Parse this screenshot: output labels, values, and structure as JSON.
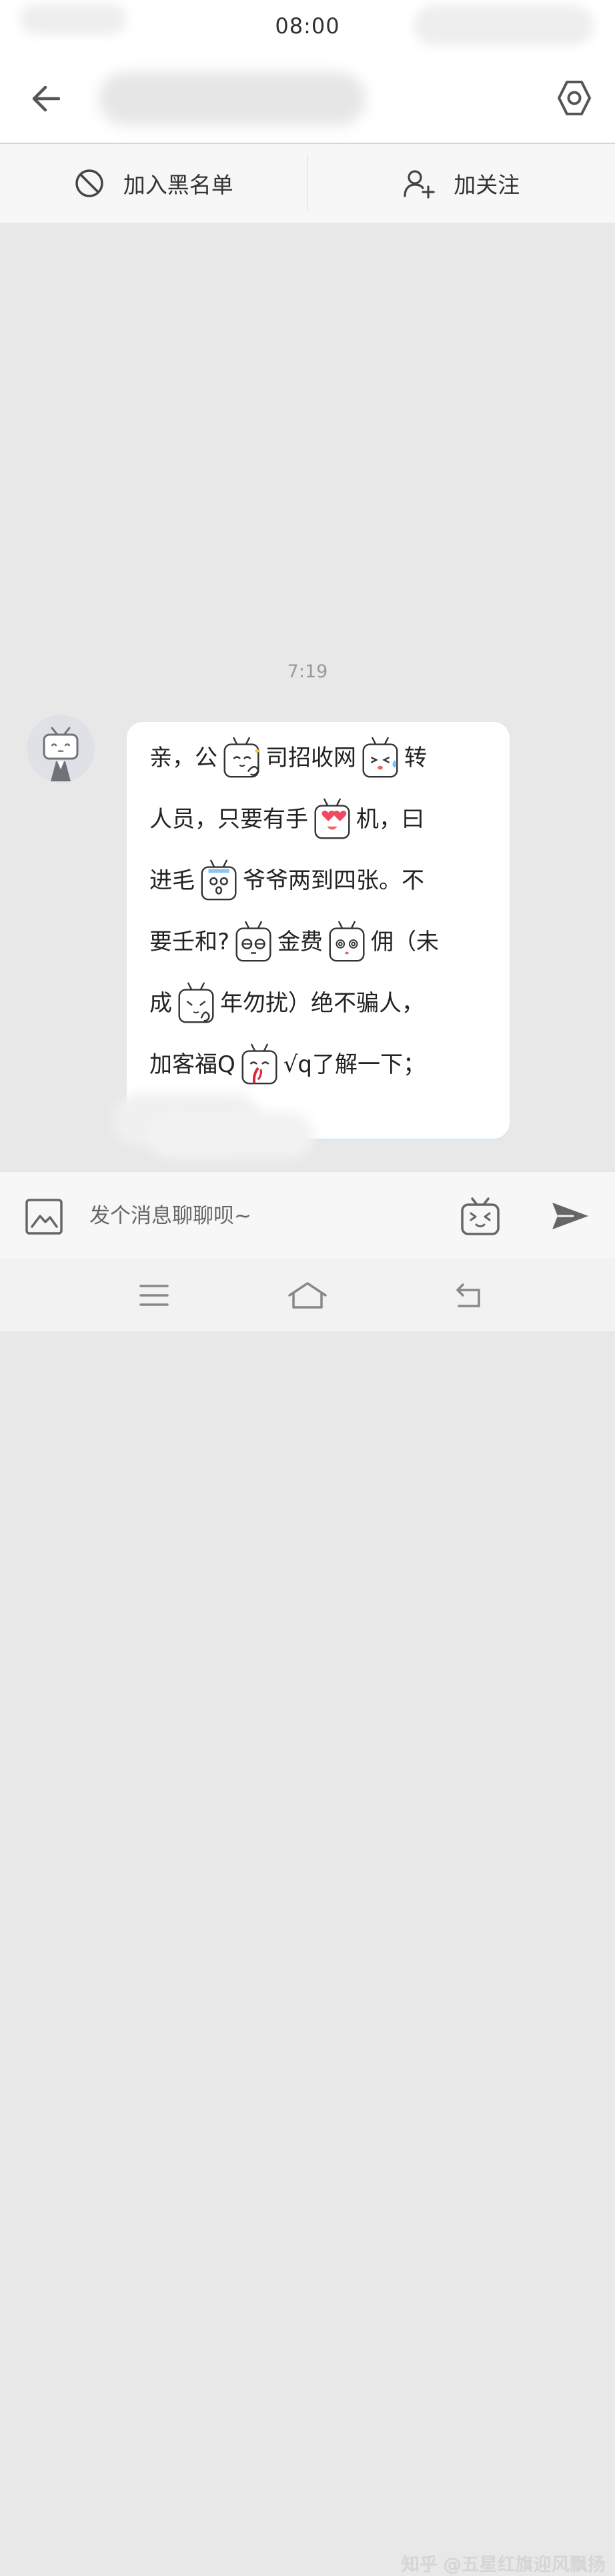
{
  "status_bar": {
    "time": "08:00"
  },
  "header": {
    "back_icon": "arrow-left-icon",
    "settings_icon": "gear-hexagon-icon"
  },
  "actions": {
    "blacklist_label": "加入黑名单",
    "blacklist_icon": "block-icon",
    "follow_label": "加关注",
    "follow_icon": "add-user-icon"
  },
  "chat": {
    "timestamp": "7:19",
    "message": {
      "avatar_icon": "tv-mascot-avatar",
      "lines": [
        [
          {
            "t": "亲，公"
          },
          {
            "e": "shy"
          },
          {
            "t": "司招收网"
          },
          {
            "e": "sweat"
          },
          {
            "t": "转"
          }
        ],
        [
          {
            "t": "人员，只要有手"
          },
          {
            "e": "heart-eyes"
          },
          {
            "t": "机，曰"
          }
        ],
        [
          {
            "t": "进毛"
          },
          {
            "e": "shocked"
          },
          {
            "t": "爷爷两到四张。不"
          }
        ],
        [
          {
            "t": "要壬和?"
          },
          {
            "e": "speechless"
          },
          {
            "t": "金费"
          },
          {
            "e": "dizzy"
          },
          {
            "t": "佣（未"
          }
        ],
        [
          {
            "t": "成"
          },
          {
            "e": "thinking"
          },
          {
            "t": "年勿扰）绝不骗人，"
          }
        ],
        [
          {
            "t": "加客福Q"
          },
          {
            "e": "nosebleed"
          },
          {
            "t": "√q了解一下；"
          }
        ]
      ]
    }
  },
  "input": {
    "placeholder": "发个消息聊聊呗~",
    "value": "",
    "image_icon": "image-icon",
    "emote_icon": "tv-emoji-icon",
    "send_icon": "send-icon"
  },
  "system_nav": {
    "menu_icon": "menu-icon",
    "home_icon": "home-icon",
    "back_icon": "return-icon"
  },
  "watermark": "知乎 @五星红旗迎风飘扬"
}
